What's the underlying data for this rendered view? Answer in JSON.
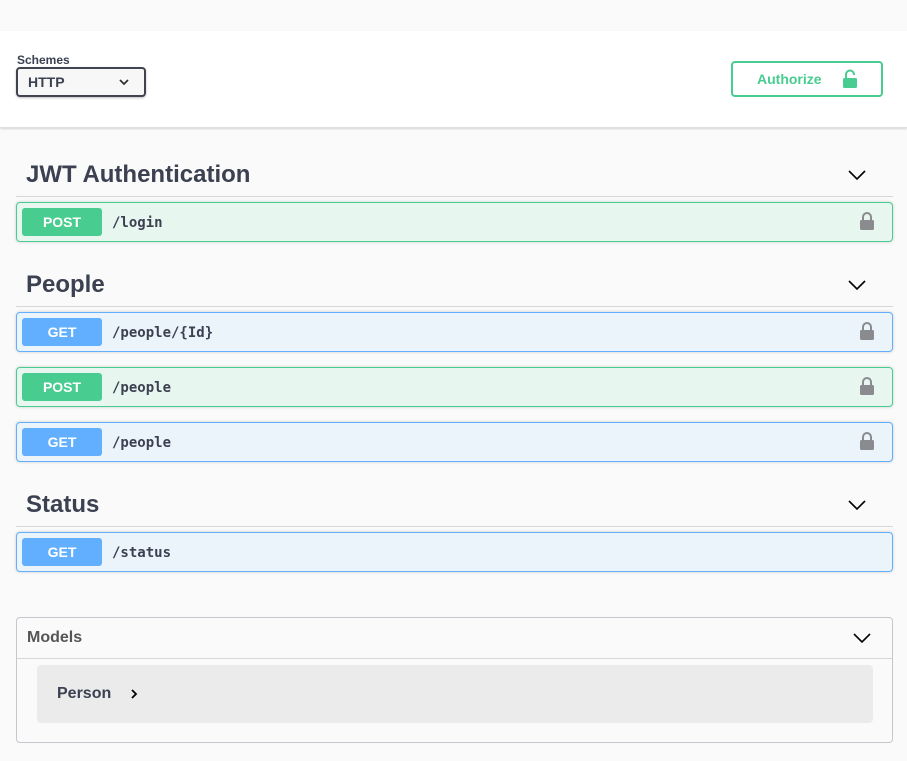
{
  "schemes": {
    "label": "Schemes",
    "selected": "HTTP"
  },
  "authorize": {
    "label": "Authorize"
  },
  "tags": [
    {
      "title": "JWT Authentication",
      "operations": [
        {
          "method": "POST",
          "path": "/login",
          "locked": true
        }
      ]
    },
    {
      "title": "People",
      "operations": [
        {
          "method": "GET",
          "path": "/people/{Id}",
          "locked": true
        },
        {
          "method": "POST",
          "path": "/people",
          "locked": true
        },
        {
          "method": "GET",
          "path": "/people",
          "locked": true
        }
      ]
    },
    {
      "title": "Status",
      "operations": [
        {
          "method": "GET",
          "path": "/status",
          "locked": false
        }
      ]
    }
  ],
  "models": {
    "title": "Models",
    "items": [
      {
        "name": "Person"
      }
    ]
  },
  "colors": {
    "post": "#49cc90",
    "get": "#61affe",
    "text": "#3b4151"
  }
}
